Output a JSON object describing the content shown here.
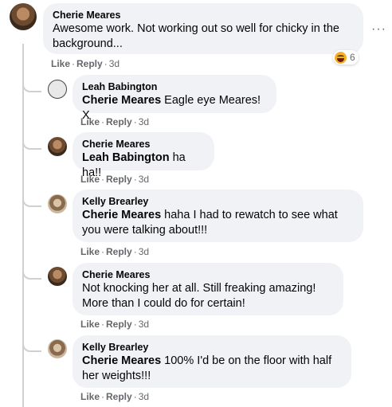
{
  "actions": {
    "like": "Like",
    "reply": "Reply",
    "sep": "·"
  },
  "more_menu": "···",
  "comments": [
    {
      "author": "Cherie Meares",
      "mention": "",
      "text": "Awesome work. Not working out so well for chicky in the background...",
      "time": "3d",
      "reaction": {
        "icon": "haha-icon",
        "count": "6"
      }
    },
    {
      "author": "Leah Babington",
      "mention": "Cherie Meares",
      "text": "Eagle eye Meares! X",
      "time": "3d"
    },
    {
      "author": "Cherie Meares",
      "mention": "Leah Babington",
      "text": "ha ha!!",
      "time": "3d"
    },
    {
      "author": "Kelly Brearley",
      "mention": "Cherie Meares",
      "text": "haha I had to rewatch to see what you were talking about!!!",
      "time": "3d"
    },
    {
      "author": "Cherie Meares",
      "mention": "",
      "text": "Not knocking her at all. Still freaking amazing! More than I could do for certain!",
      "time": "3d"
    },
    {
      "author": "Kelly Brearley",
      "mention": "Cherie Meares",
      "text": "100% I'd be on the floor with half her weights!!!",
      "time": "3d"
    }
  ]
}
